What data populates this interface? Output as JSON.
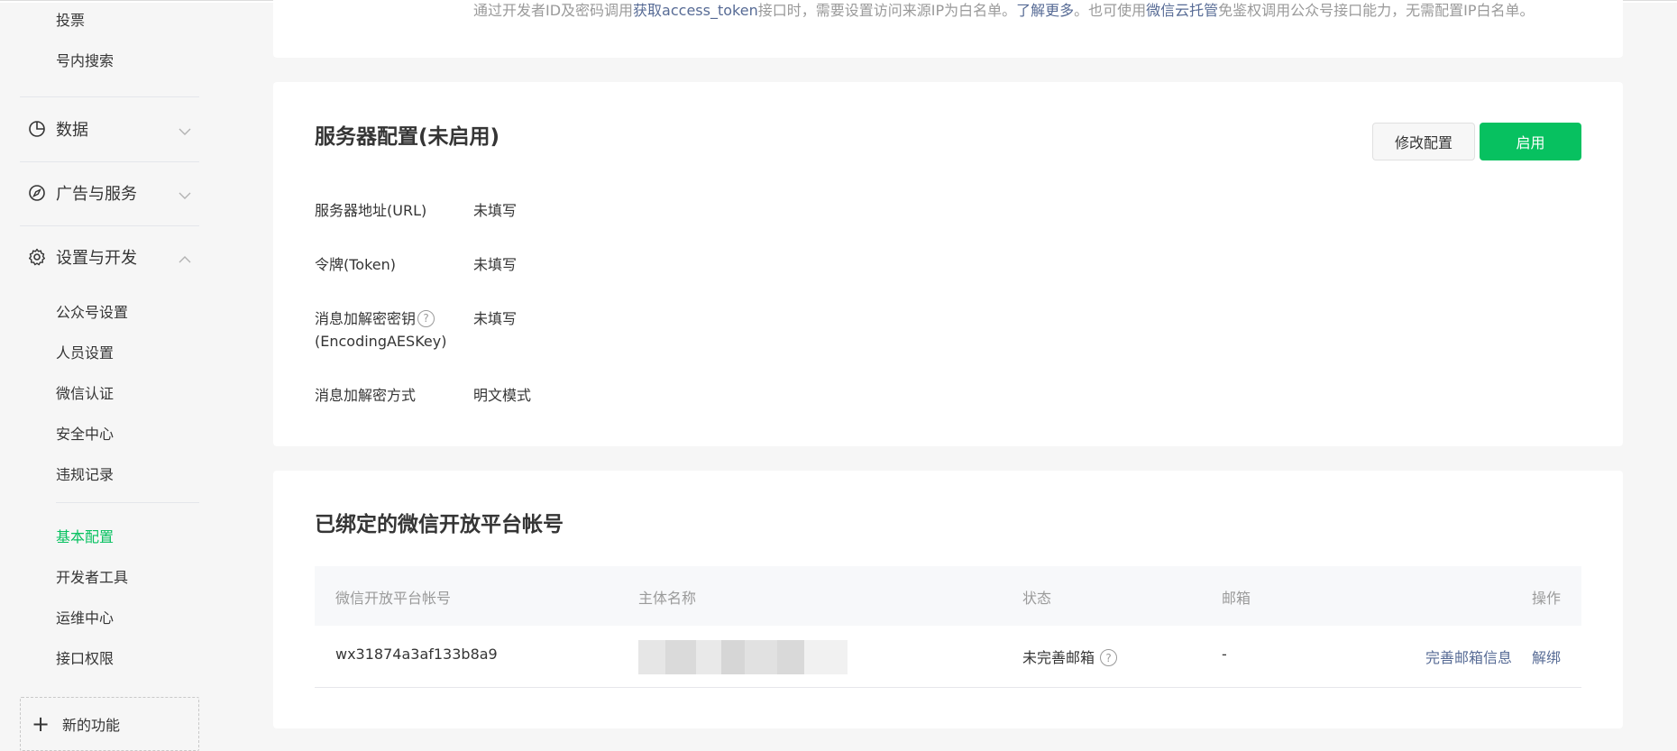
{
  "sidebar": {
    "top_items": [
      "投票",
      "号内搜索"
    ],
    "groups": [
      {
        "label": "数据",
        "icon": "pie-chart-icon",
        "expanded": false
      },
      {
        "label": "广告与服务",
        "icon": "compass-icon",
        "expanded": false
      },
      {
        "label": "设置与开发",
        "icon": "gear-icon",
        "expanded": true
      }
    ],
    "settings_items": [
      "公众号设置",
      "人员设置",
      "微信认证",
      "安全中心",
      "违规记录"
    ],
    "dev_items": [
      "基本配置",
      "开发者工具",
      "运维中心",
      "接口权限"
    ],
    "active_item": "基本配置",
    "new_feature_label": "新的功能"
  },
  "ip_note": {
    "t1": "通过开发者ID及密码调用",
    "link1": "获取access_token",
    "t2": "接口时，需要设置访问来源IP为白名单。",
    "link2": "了解更多",
    "t3": "。也可使用",
    "link3": "微信云托管",
    "t4": "免鉴权调用公众号接口能力，无需配置IP白名单。"
  },
  "server_config": {
    "title": "服务器配置(未启用)",
    "modify_label": "修改配置",
    "enable_label": "启用",
    "fields": [
      {
        "label": "服务器地址(URL)",
        "value": "未填写"
      },
      {
        "label": "令牌(Token)",
        "value": "未填写"
      },
      {
        "label": "消息加解密密钥",
        "label2": "(EncodingAESKey)",
        "value": "未填写"
      },
      {
        "label": "消息加解密方式",
        "value": "明文模式"
      }
    ],
    "help_glyph": "?"
  },
  "bound_accounts": {
    "title": "已绑定的微信开放平台帐号",
    "columns": {
      "account": "微信开放平台帐号",
      "entity": "主体名称",
      "status": "状态",
      "email": "邮箱",
      "action": "操作"
    },
    "rows": [
      {
        "account": "wx31874a3af133b8a9",
        "entity_redacted": true,
        "status": "未完善邮箱",
        "email": "-",
        "action_complete": "完善邮箱信息",
        "action_unbind": "解绑"
      }
    ]
  },
  "colors": {
    "accent": "#07c160",
    "link": "#576b95",
    "muted": "#9a9a9a"
  }
}
